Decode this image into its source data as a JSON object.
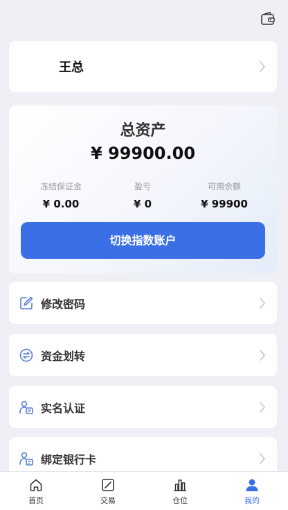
{
  "header": {
    "wallet_icon": "wallet-icon"
  },
  "user": {
    "name": "王总"
  },
  "assets": {
    "title": "总资产",
    "total": "¥  99900.00",
    "frozen_label": "冻结保证金",
    "frozen_value": "¥ 0.00",
    "pnl_label": "盈亏",
    "pnl_value": "¥ 0",
    "available_label": "可用余额",
    "available_value": "¥ 99900",
    "switch_button": "切换指数账户"
  },
  "menu": [
    {
      "label": "修改密码",
      "icon": "edit-icon"
    },
    {
      "label": "资金划转",
      "icon": "transfer-icon"
    },
    {
      "label": "实名认证",
      "icon": "id-verify-icon"
    },
    {
      "label": "绑定银行卡",
      "icon": "bank-card-icon"
    }
  ],
  "tabbar": {
    "active": "我的",
    "tabs": [
      {
        "label": "首页",
        "icon": "home-icon"
      },
      {
        "label": "交易",
        "icon": "trade-icon"
      },
      {
        "label": "仓位",
        "icon": "position-icon"
      },
      {
        "label": "我的",
        "icon": "user-icon"
      }
    ]
  },
  "colors": {
    "accent": "#3a6fe6",
    "background": "#eef0f5",
    "icon_blue": "#5a7fd6"
  }
}
